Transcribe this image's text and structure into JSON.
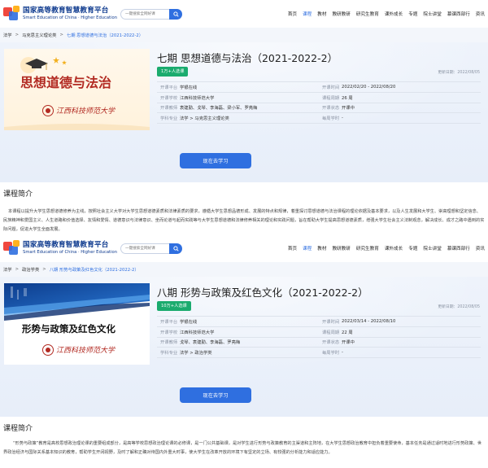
{
  "logo": {
    "cn": "国家高等教育智慧教育平台",
    "en": "Smart Education of China · Higher Education"
  },
  "search": {
    "placeholder": "一键搜索全网好课"
  },
  "nav": [
    {
      "label": "首页"
    },
    {
      "label": "课程"
    },
    {
      "label": "教材"
    },
    {
      "label": "教研教研"
    },
    {
      "label": "研究生教育"
    },
    {
      "label": "课外成长"
    },
    {
      "label": "专题"
    },
    {
      "label": "院士讲堂"
    },
    {
      "label": "慕课西部行"
    },
    {
      "label": "资讯"
    }
  ],
  "courses": [
    {
      "breadcrumb": [
        "法学",
        "马克思主义理论类",
        "七期 思想道德与法治（2021-2022-2）"
      ],
      "cover": {
        "title": "思想道德与法治",
        "school": "江西科技师范大学"
      },
      "title": "七期 思想道德与法治（2021-2022-2）",
      "badge": "1万+人选课",
      "updated": "更新日期：2022/08/05",
      "info": {
        "platform_k": "开课平台",
        "platform_v": "学银在线",
        "time_k": "开课时间",
        "time_v": "2022/02/20 - 2022/08/20",
        "school_k": "开课学校",
        "school_v": "江西科技师范大学",
        "duration_k": "课程周期",
        "duration_v": "26 周",
        "teacher_k": "开课教师",
        "teacher_v": "袁建勤、戈琴、李海磊、梁小军、罗亮梅",
        "status_k": "开课状态",
        "status_v": "开课中",
        "major_k": "学科专业",
        "major_v": "法学 > 马克思主义理论类",
        "hours_k": "每周学时",
        "hours_v": "-"
      },
      "cta": "现在去学习",
      "intro_title": "课程简介",
      "intro_text": "本课程以提升大学生思想道德修养为主线，按照社会主义大学对大学生思想道德素质和法律素质的要求，遵循大学生思想品德形成、发展的特点和规律，着重探讨思想道德与法治课程的理论依据及基本要求，以及人生发展和大学生、崇高理想和坚定信念、民族精神和爱国主义、人生道路和价值选择、友情和爱情、道德意识与法律意识、坐而论道与起而实践等与大学生思想道德和法律修养相关的理论和实践问题，旨在帮助大学生提高思想道德素质，增强大学生社会主义法制观念，解决成长、成才之路中遇到的实际问题，促进大学生全面发展。"
    },
    {
      "breadcrumb": [
        "法学",
        "政治学类",
        "八期 形势与政策及红色文化（2021-2022-2）"
      ],
      "cover": {
        "title": "形势与政策及红色文化",
        "school": "江西科技师范大学"
      },
      "title": "八期 形势与政策及红色文化（2021-2022-2）",
      "badge": "10万+人选课",
      "updated": "更新日期：2022/08/05",
      "info": {
        "platform_k": "开课平台",
        "platform_v": "学银在线",
        "time_k": "开课时间",
        "time_v": "2022/03/14 - 2022/08/10",
        "school_k": "开课学校",
        "school_v": "江西科技师范大学",
        "duration_k": "课程周期",
        "duration_v": "22 周",
        "teacher_k": "开课教师",
        "teacher_v": "戈琴、袁建勤、李海磊、罗亮梅",
        "status_k": "开课状态",
        "status_v": "开课中",
        "major_k": "学科专业",
        "major_v": "法学 > 政治学类",
        "hours_k": "每周学时",
        "hours_v": "-"
      },
      "cta": "现在去学习",
      "intro_title": "课程简介",
      "intro_text": "“形势与政策”教育是高校思想政治理论课的重要组成部分，是高等学校思想政治理论课的必修课，是一门公共基础课，是对学生进行形势与政策教育的主渠道和主阵地，在大学生思想政治教育中担负着重要使命，基本任务是通过适时地进行形势政策、世界政治经济与国际关系基本知识的教育，帮助学生开阔视野，及时了解和正确对待国内外重大时事，使大学生在改革开放的环境下有坚定的立场、有较强的分析能力和适应能力。"
    }
  ]
}
